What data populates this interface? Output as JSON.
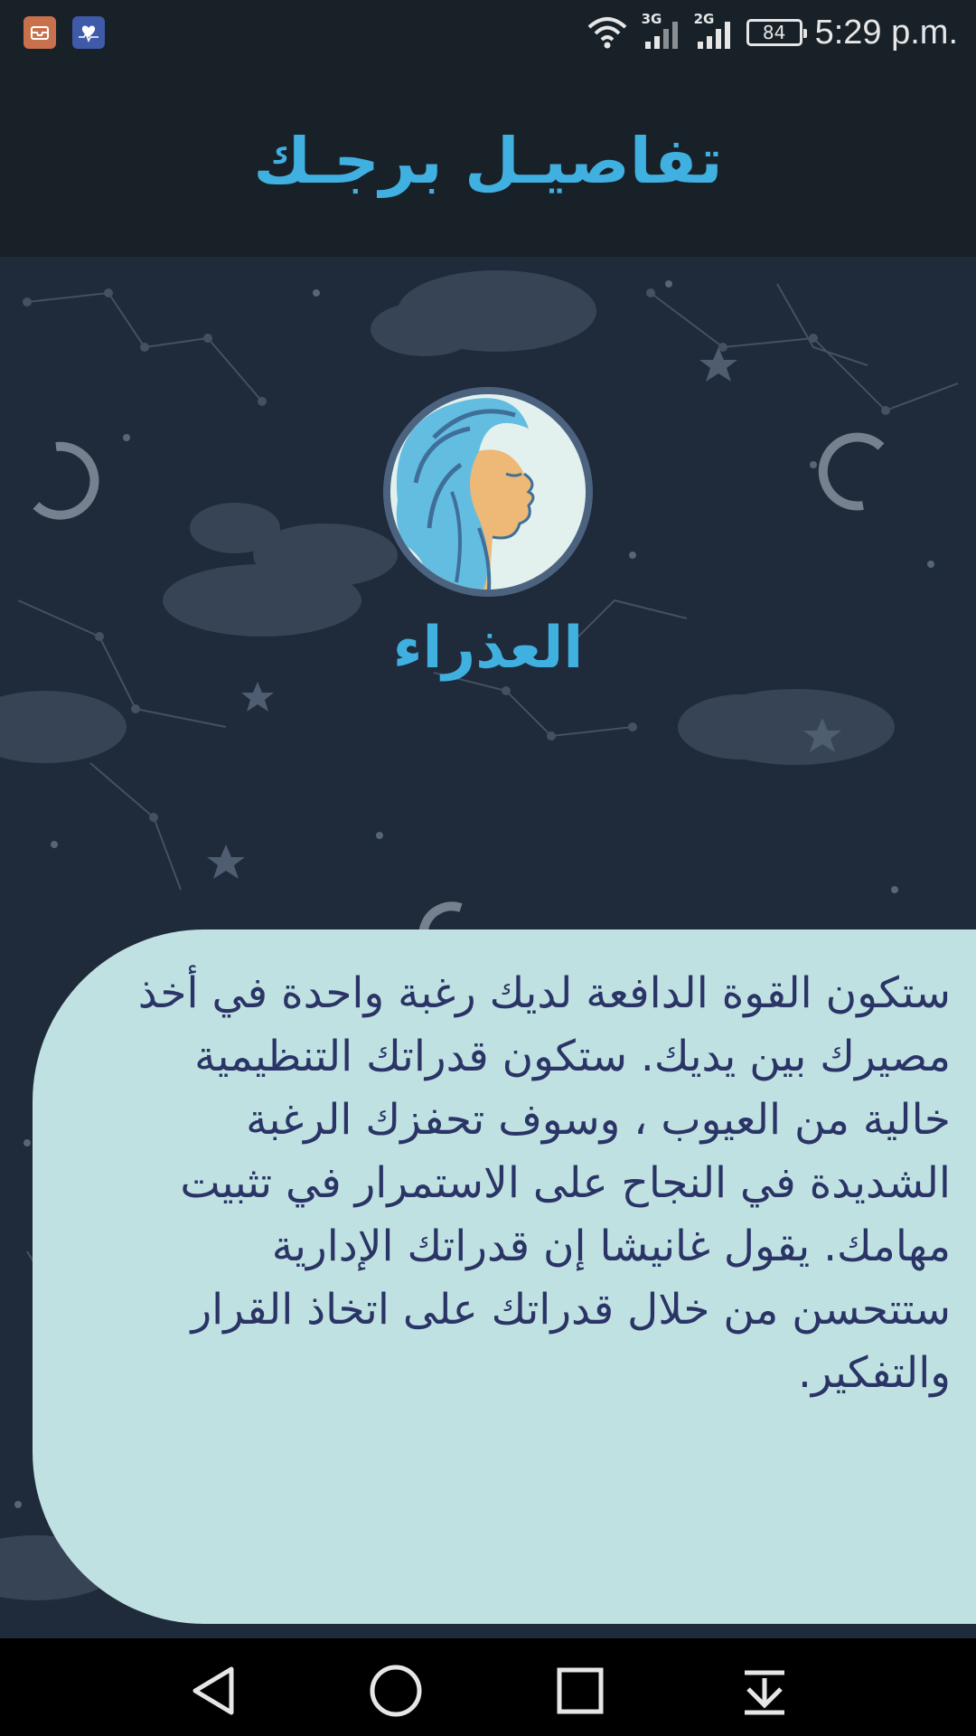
{
  "status_bar": {
    "time": "5:29 p.m.",
    "battery": "84",
    "network_1": "3G",
    "network_2": "2G",
    "notifications": [
      "mail-icon",
      "health-icon"
    ]
  },
  "app_bar": {
    "title": "تفاصيـل برجـك"
  },
  "sign": {
    "name": "العذراء",
    "icon": "virgo-icon"
  },
  "description": {
    "text": "ستكون القوة الدافعة لديك رغبة واحدة في أخذ مصيرك بين يديك. ستكون قدراتك التنظيمية خالية من العيوب ، وسوف تحفزك الرغبة الشديدة في النجاح على الاستمرار في تثبيت مهامك. يقول غانيشا إن قدراتك الإدارية ستتحسن من خلال قدراتك على اتخاذ القرار والتفكير."
  },
  "nav_bar": {
    "buttons": [
      "back-icon",
      "home-icon",
      "recents-icon",
      "notification-drawer-icon"
    ]
  },
  "colors": {
    "accent": "#3fb0e0",
    "card_bg": "#c0e1e1",
    "card_text": "#2a3466",
    "header_bg": "#182128",
    "sky_bg": "#1f2a3a"
  }
}
